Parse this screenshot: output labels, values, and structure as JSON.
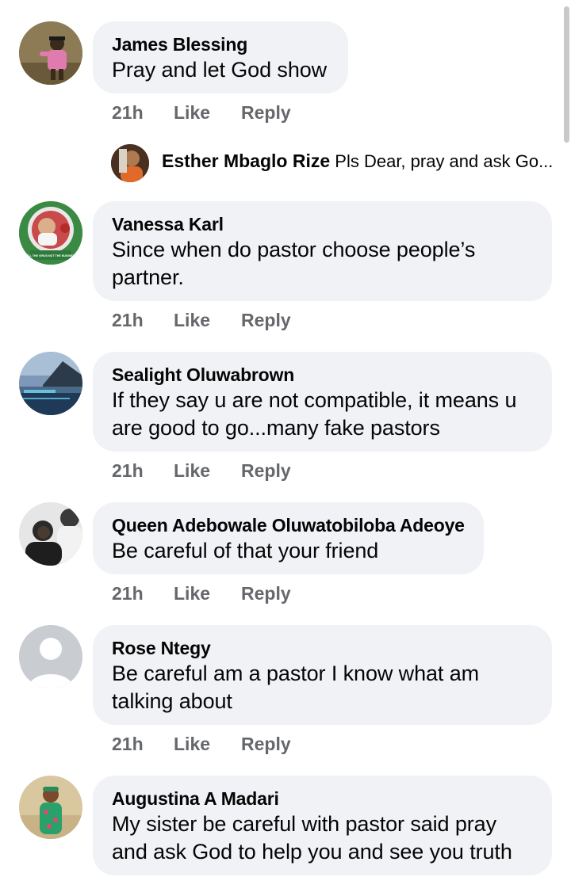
{
  "actions": {
    "like": "Like",
    "reply": "Reply"
  },
  "comments": [
    {
      "name": "James Blessing",
      "text": "Pray and let God show",
      "time": "21h"
    },
    {
      "name": "Vanessa Karl",
      "text": "Since when do pastor choose people’s partner.",
      "time": "21h"
    },
    {
      "name": "Sealight Oluwabrown",
      "text": "If they say u are not compatible, it means u are good to go...many fake pastors",
      "time": "21h"
    },
    {
      "name": "Queen Adebowale Oluwatobiloba Adeoye",
      "text": "Be careful of that your friend",
      "time": "21h"
    },
    {
      "name": "Rose Ntegy",
      "text": "Be careful am a pastor I know what am talking about",
      "time": "21h"
    },
    {
      "name": "Augustina A Madari",
      "text": "My sister be careful with pastor said pray and ask God to help you and see you truth"
    }
  ],
  "reply_preview": {
    "name": "Esther Mbaglo Rize",
    "text": "Pls Dear, pray and ask Go..."
  },
  "avatar_badges": {
    "vanessa": "KILL THE VIRUS NOT THE BUSINESS"
  },
  "colors": {
    "bubble": "#f0f2f5",
    "meta_text": "#65676b",
    "text": "#050505"
  }
}
